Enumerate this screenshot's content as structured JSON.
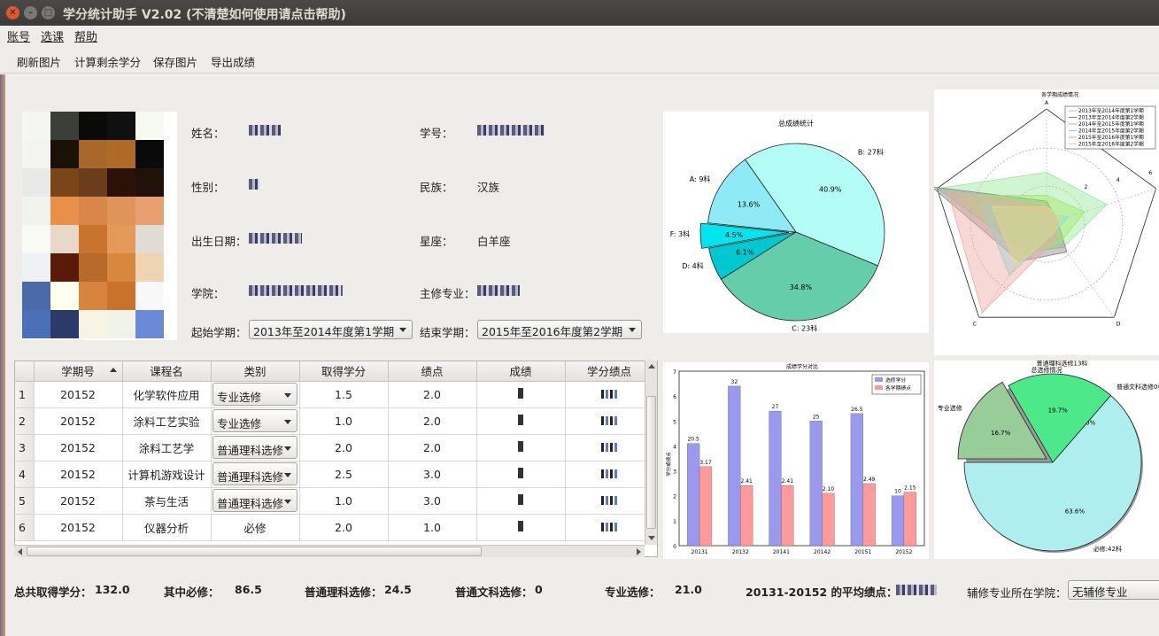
{
  "window": {
    "title": "学分统计助手 V2.02 (不清楚如何使用请点击帮助)"
  },
  "menu": [
    "账号",
    "选课",
    "帮助"
  ],
  "toolbar": [
    "刷新图片",
    "计算剩余学分",
    "保存图片",
    "导出成绩"
  ],
  "info": {
    "name_label": "姓名：",
    "id_label": "学号：",
    "gender_label": "性别：",
    "ethnicity_label": "民族：",
    "ethnicity": "汉族",
    "birth_label": "出生日期：",
    "zodiac_label": "星座：",
    "zodiac": "白羊座",
    "college_label": "学院：",
    "major_label": "主修专业：",
    "start_label": "起始学期：",
    "start_value": "2013年至2014年度第1学期",
    "end_label": "结束学期：",
    "end_value": "2015年至2016年度第2学期"
  },
  "table": {
    "headers": [
      "学期号",
      "课程名",
      "类别",
      "取得学分",
      "绩点",
      "成绩",
      "学分绩点"
    ],
    "rows": [
      {
        "n": "1",
        "term": "20152",
        "course": "化学软件应用",
        "type": "专业选修",
        "combo": true,
        "credit": "1.5",
        "gpa": "2.0"
      },
      {
        "n": "2",
        "term": "20152",
        "course": "涂料工艺实验",
        "type": "专业选修",
        "combo": true,
        "credit": "1.0",
        "gpa": "2.0"
      },
      {
        "n": "3",
        "term": "20152",
        "course": "涂料工艺学",
        "type": "普通理科选修",
        "combo": true,
        "credit": "2.0",
        "gpa": "2.0"
      },
      {
        "n": "4",
        "term": "20152",
        "course": "计算机游戏设计",
        "type": "普通理科选修",
        "combo": true,
        "credit": "2.5",
        "gpa": "3.0"
      },
      {
        "n": "5",
        "term": "20152",
        "course": "茶与生活",
        "type": "普通理科选修",
        "combo": true,
        "credit": "1.0",
        "gpa": "3.0"
      },
      {
        "n": "6",
        "term": "20152",
        "course": "仪器分析",
        "type": "必修",
        "combo": false,
        "credit": "2.0",
        "gpa": "1.0"
      }
    ]
  },
  "summary": {
    "total_label": "总共取得学分：",
    "total": "132.0",
    "req_label": "其中必修：",
    "req": "86.5",
    "sci_label": "普通理科选修：",
    "sci": "24.5",
    "arts_label": "普通文科选修：",
    "arts": "0",
    "major_label": "专业选修：",
    "major": "21.0",
    "avg_label": "20131-20152 的平均绩点：",
    "minor_label": "辅修专业所在学院：",
    "minor_value": "无辅修专业"
  },
  "chart_data": [
    {
      "type": "pie",
      "title": "总成绩统计",
      "slices": [
        {
          "label": "A: 9科",
          "pct": "13.6%",
          "value": 9,
          "color": "#8eeaf5"
        },
        {
          "label": "F: 3科",
          "pct": "4.5%",
          "value": 3,
          "color": "#00e5ee"
        },
        {
          "label": "D: 4科",
          "pct": "6.1%",
          "value": 4,
          "color": "#00c8d0"
        },
        {
          "label": "C: 23科",
          "pct": "34.8%",
          "value": 23,
          "color": "#66cdaa"
        },
        {
          "label": "B: 27科",
          "pct": "40.9%",
          "value": 27,
          "color": "#b4fdf6"
        }
      ]
    },
    {
      "type": "radar",
      "title": "各学期成绩情况",
      "axes": [
        "A",
        "B",
        "C",
        "D",
        "E"
      ],
      "ticks": [
        "2",
        "4",
        "6"
      ],
      "legend": [
        "2013年至2014年度第1学期",
        "2013年至2014年度第2学期",
        "2014年至2015年度第1学期",
        "2014年至2015年度第2学期",
        "2015年至2016年度第1学期",
        "2015年至2016年度第2学期"
      ],
      "legend_colors": [
        "#98e898",
        "#888888",
        "#a0e868",
        "#6aeaea",
        "#f0a8a0",
        "#e8d880"
      ]
    },
    {
      "type": "bar",
      "title": "成绩学分对比",
      "ylabel": "学分或绩点",
      "categories": [
        "20131",
        "20132",
        "20141",
        "20142",
        "20151",
        "20152"
      ],
      "ylim": [
        0,
        7
      ],
      "yticks": [
        "0",
        "1",
        "2",
        "3",
        "4",
        "5",
        "6",
        "7"
      ],
      "series": [
        {
          "name": "选修学分",
          "values": [
            4.1,
            6.4,
            5.4,
            5.0,
            5.3,
            2.0
          ],
          "labels": [
            "20.5",
            "32",
            "27",
            "25",
            "26.5",
            "10"
          ],
          "color": "#9999f0"
        },
        {
          "name": "各学期绩点",
          "values": [
            3.17,
            2.41,
            2.41,
            2.1,
            2.49,
            2.15
          ],
          "labels": [
            "3.17",
            "2.41",
            "2.41",
            "2.10",
            "2.49",
            "2.15"
          ],
          "color": "#ff9a9a"
        }
      ]
    },
    {
      "type": "pie",
      "title": "总选修情况",
      "slices": [
        {
          "label": "必修:42科",
          "pct": "63.6%",
          "value": 42,
          "color": "#afeeee"
        },
        {
          "label": "普通文科选修0科",
          "pct": "0.0%",
          "value": 0,
          "color": "#77dd88"
        },
        {
          "label": "普通理科选修13科",
          "pct": "19.7%",
          "value": 13,
          "color": "#4ce88a"
        },
        {
          "label": "专业选修",
          "pct": "16.7%",
          "value": 11,
          "color": "#98cc98"
        }
      ]
    }
  ]
}
